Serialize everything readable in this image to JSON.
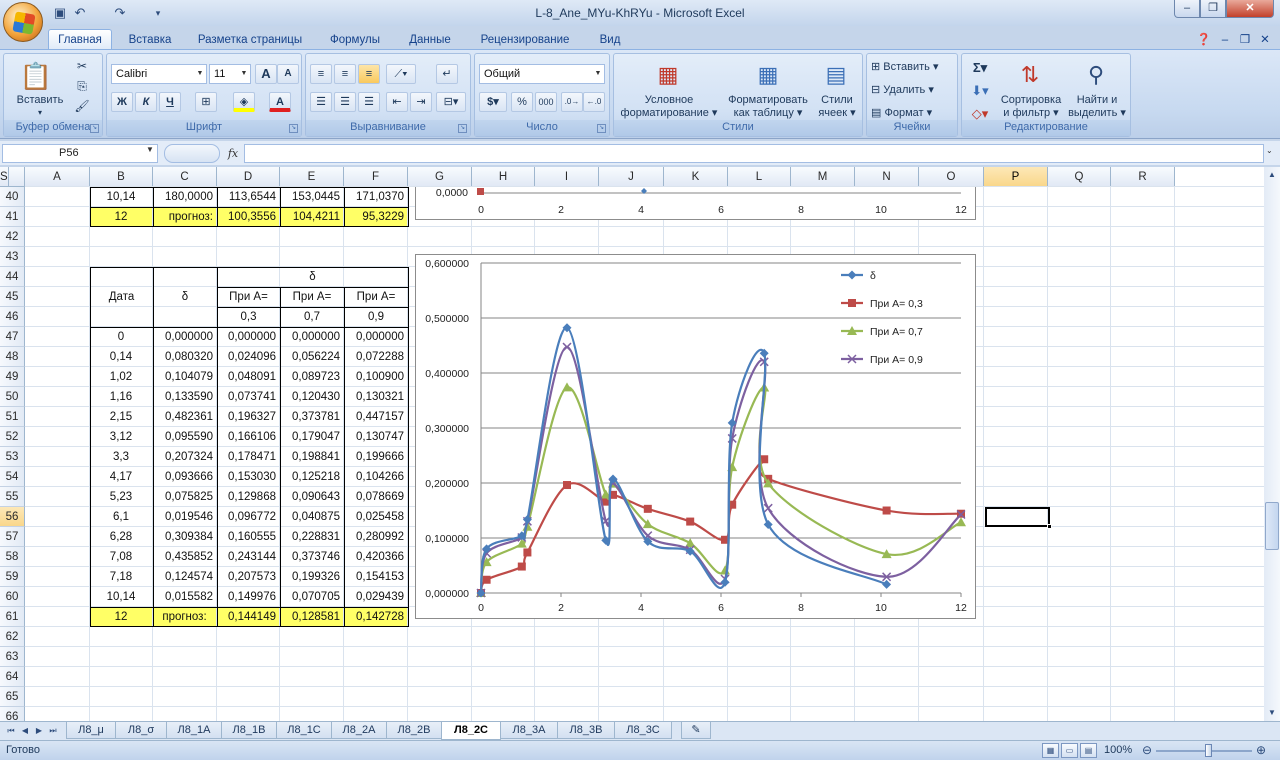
{
  "window": {
    "title": "L-8_Ane_MYu-KhRYu - Microsoft Excel"
  },
  "ribbon_tabs": [
    "Главная",
    "Вставка",
    "Разметка страницы",
    "Формулы",
    "Данные",
    "Рецензирование",
    "Вид"
  ],
  "ribbon": {
    "clipboard": {
      "group": "Буфер обмена",
      "paste": "Вставить"
    },
    "font": {
      "group": "Шрифт",
      "name": "Calibri",
      "size": "11",
      "bold": "Ж",
      "italic": "К",
      "underline": "Ч",
      "grow": "A",
      "shrink": "A"
    },
    "alignment": {
      "group": "Выравнивание"
    },
    "number": {
      "group": "Число",
      "format": "Общий",
      "currency": "$",
      "percent": "%",
      "thousands": "000"
    },
    "styles": {
      "group": "Стили",
      "cond_format_1": "Условное",
      "cond_format_2": "форматирование",
      "format_table_1": "Форматировать",
      "format_table_2": "как таблицу",
      "cell_styles_1": "Стили",
      "cell_styles_2": "ячеек"
    },
    "cells": {
      "group": "Ячейки",
      "insert": "Вставить",
      "delete": "Удалить",
      "format": "Формат"
    },
    "editing": {
      "group": "Редактирование",
      "sum": "Σ",
      "sort_1": "Сортировка",
      "sort_2": "и фильтр",
      "find_1": "Найти и",
      "find_2": "выделить"
    }
  },
  "formula_bar": {
    "name_box": "P56",
    "fx": "fx",
    "formula": ""
  },
  "columns": [
    "A",
    "B",
    "C",
    "D",
    "E",
    "F",
    "G",
    "H",
    "I",
    "J",
    "K",
    "L",
    "M",
    "N",
    "O",
    "P",
    "Q",
    "R",
    "S"
  ],
  "selected_column": "P",
  "row_numbers": [
    "40",
    "41",
    "42",
    "43",
    "44",
    "45",
    "46",
    "47",
    "48",
    "49",
    "50",
    "51",
    "52",
    "53",
    "54",
    "55",
    "56",
    "57",
    "58",
    "59",
    "60",
    "61",
    "62",
    "63",
    "64",
    "65",
    "66"
  ],
  "selected_row": "56",
  "row40": [
    "10,14",
    "180,0000",
    "113,6544",
    "153,0445",
    "171,0370"
  ],
  "row41": [
    "12",
    "прогноз:",
    "100,3556",
    "104,4211",
    "95,3229"
  ],
  "table": {
    "delta_header": "δ",
    "date_header": "Дата",
    "delta_col_header": "δ",
    "a_label": "При А=",
    "a_values": [
      "0,3",
      "0,7",
      "0,9"
    ],
    "rows": [
      [
        "0",
        "0,000000",
        "0,000000",
        "0,000000",
        "0,000000"
      ],
      [
        "0,14",
        "0,080320",
        "0,024096",
        "0,056224",
        "0,072288"
      ],
      [
        "1,02",
        "0,104079",
        "0,048091",
        "0,089723",
        "0,100900"
      ],
      [
        "1,16",
        "0,133590",
        "0,073741",
        "0,120430",
        "0,130321"
      ],
      [
        "2,15",
        "0,482361",
        "0,196327",
        "0,373781",
        "0,447157"
      ],
      [
        "3,12",
        "0,095590",
        "0,166106",
        "0,179047",
        "0,130747"
      ],
      [
        "3,3",
        "0,207324",
        "0,178471",
        "0,198841",
        "0,199666"
      ],
      [
        "4,17",
        "0,093666",
        "0,153030",
        "0,125218",
        "0,104266"
      ],
      [
        "5,23",
        "0,075825",
        "0,129868",
        "0,090643",
        "0,078669"
      ],
      [
        "6,1",
        "0,019546",
        "0,096772",
        "0,040875",
        "0,025458"
      ],
      [
        "6,28",
        "0,309384",
        "0,160555",
        "0,228831",
        "0,280992"
      ],
      [
        "7,08",
        "0,435852",
        "0,243144",
        "0,373746",
        "0,420366"
      ],
      [
        "7,18",
        "0,124574",
        "0,207573",
        "0,199326",
        "0,154153"
      ],
      [
        "10,14",
        "0,015582",
        "0,149976",
        "0,070705",
        "0,029439"
      ]
    ],
    "forecast": [
      "12",
      "прогноз:",
      "0,144149",
      "0,128581",
      "0,142728"
    ]
  },
  "chart_top": {
    "x_ticks": [
      "0",
      "2",
      "4",
      "6",
      "8",
      "10",
      "12"
    ],
    "y_tick": "0,0000"
  },
  "chart_data": {
    "type": "scatter",
    "x": [
      0,
      0.14,
      1.02,
      1.16,
      2.15,
      3.12,
      3.3,
      4.17,
      5.23,
      6.1,
      6.28,
      7.08,
      7.18,
      10.14,
      12
    ],
    "xlim": [
      0,
      12
    ],
    "ylim": [
      0,
      0.6
    ],
    "x_ticks": [
      "0",
      "2",
      "4",
      "6",
      "8",
      "10",
      "12"
    ],
    "y_ticks": [
      "0,000000",
      "0,100000",
      "0,200000",
      "0,300000",
      "0,400000",
      "0,500000",
      "0,600000"
    ],
    "grid": true,
    "smooth": true,
    "legend_position": "top-right",
    "series": [
      {
        "name": "δ",
        "color": "#4a7ebb",
        "marker": "diamond",
        "values": [
          0,
          0.08032,
          0.104079,
          0.13359,
          0.482361,
          0.09559,
          0.207324,
          0.093666,
          0.075825,
          0.019546,
          0.309384,
          0.435852,
          0.124574,
          0.015582,
          null
        ]
      },
      {
        "name": "При А= 0,3",
        "color": "#be4b48",
        "marker": "square",
        "values": [
          0,
          0.024096,
          0.048091,
          0.073741,
          0.196327,
          0.166106,
          0.178471,
          0.15303,
          0.129868,
          0.096772,
          0.160555,
          0.243144,
          0.207573,
          0.149976,
          0.144149
        ]
      },
      {
        "name": "При А= 0,7",
        "color": "#98b954",
        "marker": "triangle",
        "values": [
          0,
          0.056224,
          0.089723,
          0.12043,
          0.373781,
          0.179047,
          0.198841,
          0.125218,
          0.090643,
          0.040875,
          0.228831,
          0.373746,
          0.199326,
          0.070705,
          0.128581
        ]
      },
      {
        "name": "При А= 0,9",
        "color": "#7d60a0",
        "marker": "x",
        "values": [
          0,
          0.072288,
          0.1009,
          0.130321,
          0.447157,
          0.130747,
          0.199666,
          0.104266,
          0.078669,
          0.025458,
          0.280992,
          0.420366,
          0.154153,
          0.029439,
          0.142728
        ]
      }
    ]
  },
  "sheet_tabs": [
    "Л8_μ",
    "Л8_σ",
    "Л8_1А",
    "Л8_1В",
    "Л8_1С",
    "Л8_2А",
    "Л8_2В",
    "Л8_2С",
    "Л8_3А",
    "Л8_3В",
    "Л8_3С"
  ],
  "active_sheet": "Л8_2С",
  "status": {
    "ready": "Готово",
    "zoom": "100%"
  }
}
